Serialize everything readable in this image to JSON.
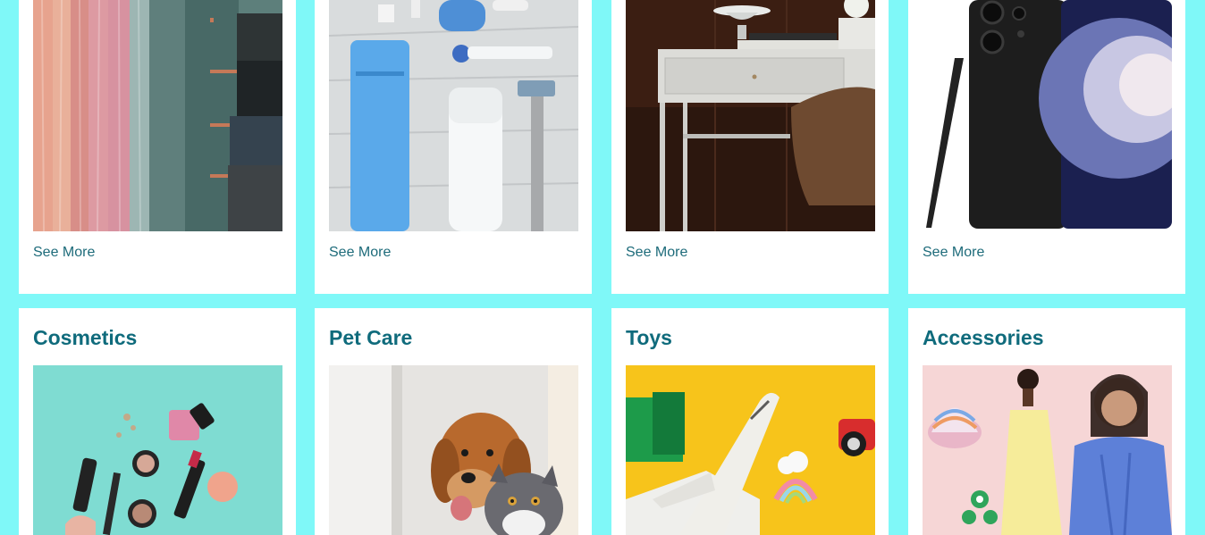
{
  "colors": {
    "page_background": "#7ff8f8",
    "card_background": "#ffffff",
    "title": "#0f6b7c",
    "link": "#1d6b7a"
  },
  "top_row": [
    {
      "image": "curtains-fabric-photo",
      "link_label": "See More"
    },
    {
      "image": "personal-care-products-photo",
      "link_label": "See More"
    },
    {
      "image": "desk-furniture-photo",
      "link_label": "See More"
    },
    {
      "image": "smartphone-photo",
      "link_label": "See More"
    }
  ],
  "bottom_row": [
    {
      "title": "Cosmetics",
      "image": "cosmetics-photo"
    },
    {
      "title": "Pet Care",
      "image": "dog-and-cat-photo"
    },
    {
      "title": "Toys",
      "image": "toy-airplane-photo"
    },
    {
      "title": "Accessories",
      "image": "fashion-accessories-photo"
    }
  ]
}
